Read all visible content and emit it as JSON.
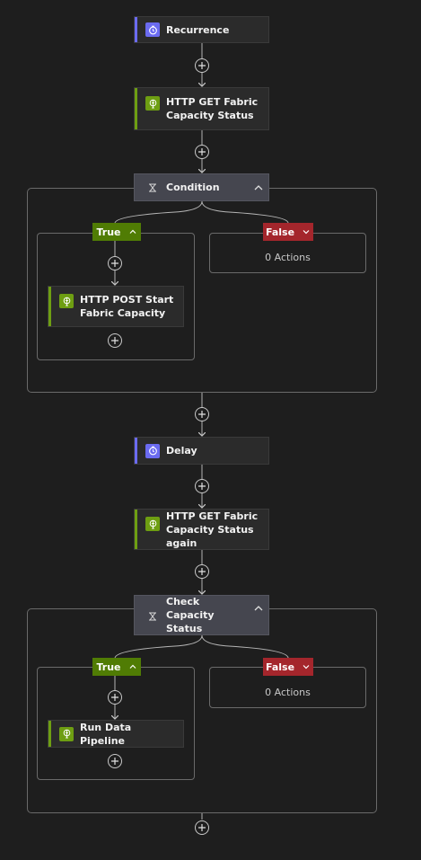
{
  "flow": {
    "recurrence": {
      "label": "Recurrence",
      "icon": "clock-icon"
    },
    "http_get_status": {
      "label": "HTTP GET Fabric Capacity Status",
      "icon": "globe-icon"
    },
    "condition": {
      "label": "Condition",
      "icon": "condition-icon",
      "true_branch": {
        "label": "True",
        "action": {
          "label": "HTTP POST Start Fabric Capacity",
          "icon": "globe-icon"
        }
      },
      "false_branch": {
        "label": "False",
        "actions_text": "0 Actions"
      }
    },
    "delay": {
      "label": "Delay",
      "icon": "clock-icon"
    },
    "http_get_status_again": {
      "label": "HTTP GET Fabric Capacity Status again",
      "icon": "globe-icon"
    },
    "check_capacity": {
      "label": "Check Capacity Status",
      "icon": "condition-icon",
      "true_branch": {
        "label": "True",
        "action": {
          "label": "Run Data Pipeline",
          "icon": "globe-icon"
        }
      },
      "false_branch": {
        "label": "False",
        "actions_text": "0 Actions"
      }
    }
  },
  "colors": {
    "background": "#1e1e1e",
    "card": "#2b2b2b",
    "trigger_accent": "#6b6bf0",
    "http_accent": "#6e9e12",
    "true_badge": "#507c04",
    "false_badge": "#a4262c",
    "condition_header": "#45464f"
  }
}
